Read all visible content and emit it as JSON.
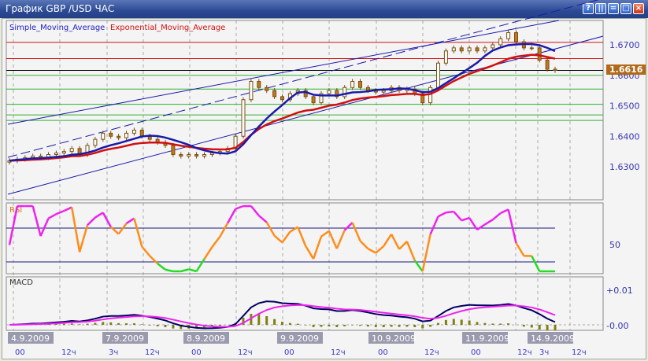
{
  "window": {
    "title": "График GBP /USD  ЧАС",
    "buttons": [
      "?",
      "||",
      "=",
      "□",
      "×"
    ]
  },
  "legend": {
    "sma": "Simple_Moving_Average",
    "ema": "Exponential_Moving_Average"
  },
  "price_axis": {
    "ticks": [
      "1.6700",
      "1.6600",
      "1.6500",
      "1.6400",
      "1.6300"
    ],
    "tick_values": [
      1.67,
      1.66,
      1.65,
      1.64,
      1.63
    ],
    "current": "1.6616",
    "current_value": 1.6616
  },
  "rsi": {
    "label": "RSI",
    "tick": "50",
    "levels": [
      30,
      70
    ]
  },
  "macd": {
    "label": "MACD",
    "ticks": [
      "+0.01",
      "-0.00"
    ]
  },
  "time_axis": {
    "dates": [
      "4.9.2009",
      "7.9.2009",
      "8.9.2009",
      "9.9.2009",
      "10.9.2009",
      "11.9.2009",
      "14.9.2009"
    ],
    "hours": [
      "00",
      "12ч",
      "3ч",
      "12ч",
      "00",
      "12ч",
      "00",
      "12ч",
      "00",
      "12ч",
      "00",
      "12ч",
      "3ч",
      "12ч"
    ]
  },
  "colors": {
    "sma": "#1a1aaa",
    "ema": "#d01010",
    "bull": "#ffffff",
    "bear": "#c07820",
    "rsi": "#ff8c1a",
    "rsi_high": "#ee22ee",
    "rsi_low": "#22dd22",
    "macd": "#000060",
    "signal": "#ee22ee",
    "hist": "#808010"
  },
  "chart_data": {
    "type": "candlestick",
    "title": "GBP/USD H1",
    "ylim": [
      1.625,
      1.676
    ],
    "levels": {
      "red": [
        1.6708,
        1.6655
      ],
      "black": [
        1.6616
      ],
      "green": [
        1.66,
        1.6555,
        1.6505,
        1.647,
        1.6452
      ]
    },
    "closes": [
      1.632,
      1.6325,
      1.633,
      1.6335,
      1.633,
      1.634,
      1.6345,
      1.635,
      1.636,
      1.634,
      1.637,
      1.639,
      1.641,
      1.64,
      1.6395,
      1.641,
      1.642,
      1.64,
      1.639,
      1.638,
      1.637,
      1.634,
      1.6335,
      1.634,
      1.6335,
      1.634,
      1.6345,
      1.635,
      1.636,
      1.64,
      1.652,
      1.658,
      1.656,
      1.655,
      1.653,
      1.652,
      1.654,
      1.655,
      1.653,
      1.651,
      1.654,
      1.655,
      1.653,
      1.656,
      1.658,
      1.656,
      1.655,
      1.6545,
      1.655,
      1.656,
      1.655,
      1.6555,
      1.654,
      1.651,
      1.656,
      1.664,
      1.668,
      1.669,
      1.668,
      1.669,
      1.668,
      1.669,
      1.67,
      1.672,
      1.674,
      1.671,
      1.669,
      1.669,
      1.665,
      1.662,
      1.6616
    ]
  }
}
